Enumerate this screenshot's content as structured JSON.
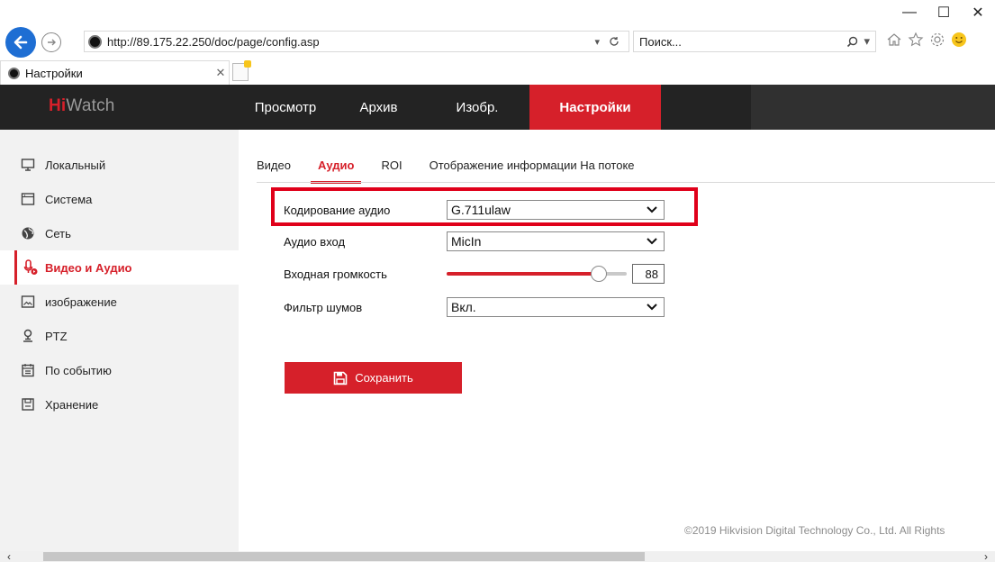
{
  "browser": {
    "url": "http://89.175.22.250/doc/page/config.asp",
    "search_placeholder": "Поиск...",
    "tab_title": "Настройки",
    "window_controls": {
      "minimize": "—",
      "maximize": "☐",
      "close": "✕"
    }
  },
  "app": {
    "logo_hi": "Hi",
    "logo_rest": "Watch",
    "brand_red": "#d6202a",
    "nav": [
      {
        "label": "Просмотр",
        "active": false
      },
      {
        "label": "Архив",
        "active": false
      },
      {
        "label": "Изобр.",
        "active": false
      },
      {
        "label": "Настройки",
        "active": true
      }
    ]
  },
  "sidebar": {
    "items": [
      {
        "label": "Локальный",
        "icon": "monitor-icon",
        "active": false
      },
      {
        "label": "Система",
        "icon": "system-icon",
        "active": false
      },
      {
        "label": "Сеть",
        "icon": "network-globe-icon",
        "active": false
      },
      {
        "label": "Видео и Аудио",
        "icon": "video-audio-icon",
        "active": true
      },
      {
        "label": "изображение",
        "icon": "image-icon",
        "active": false
      },
      {
        "label": "PTZ",
        "icon": "ptz-camera-icon",
        "active": false
      },
      {
        "label": "По событию",
        "icon": "event-calendar-icon",
        "active": false
      },
      {
        "label": "Хранение",
        "icon": "storage-disk-icon",
        "active": false
      }
    ]
  },
  "subtabs": [
    {
      "label": "Видео",
      "active": false
    },
    {
      "label": "Аудио",
      "active": true
    },
    {
      "label": "ROI",
      "active": false
    },
    {
      "label": "Отображение информации На потоке",
      "active": false
    }
  ],
  "form": {
    "audio_encoding": {
      "label": "Кодирование аудио",
      "value": "G.711ulaw"
    },
    "audio_input": {
      "label": "Аудио вход",
      "value": "MicIn"
    },
    "input_volume": {
      "label": "Входная громкость",
      "value": "88",
      "max": 100
    },
    "noise_filter": {
      "label": "Фильтр шумов",
      "value": "Вкл."
    }
  },
  "save_label": "Сохранить",
  "footer": "©2019 Hikvision Digital Technology Co., Ltd. All Rights"
}
